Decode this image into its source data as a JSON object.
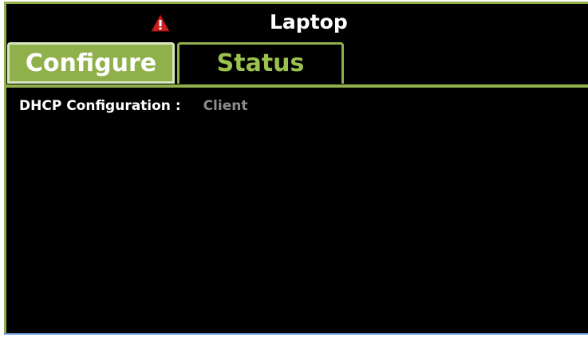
{
  "header": {
    "title": "Laptop",
    "alert_icon": "warning-triangle-icon",
    "alert_color": "#cc1f1f"
  },
  "tabs": [
    {
      "label": "Configure",
      "active": true
    },
    {
      "label": "Status",
      "active": false
    }
  ],
  "settings": {
    "dhcp_label": "DHCP Configuration :",
    "dhcp_value": "Client"
  },
  "colors": {
    "accent": "#8fb04a",
    "background": "#000000",
    "status_text": "#9bc24f"
  }
}
